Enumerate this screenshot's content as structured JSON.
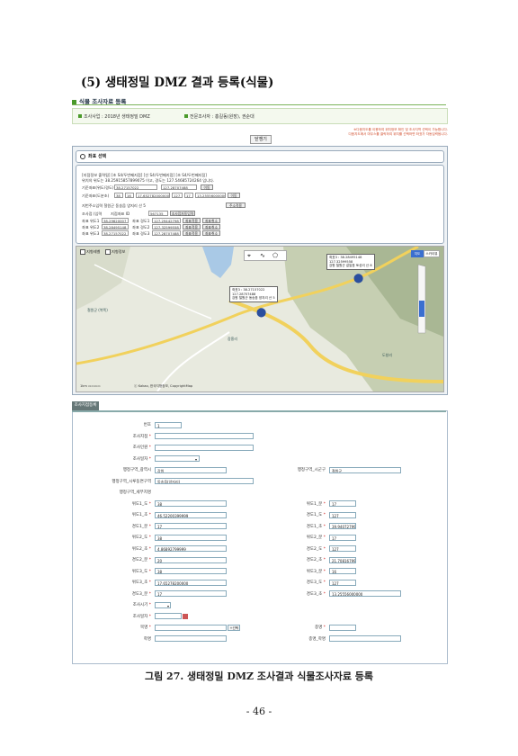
{
  "heading": "(5) 생태정밀 DMZ 결과 등록(식물)",
  "section_title": "식물 조사자료 등록",
  "info": {
    "project_label": "조사사업 : 2018년 생태정밀 DMZ",
    "surveyor_label": "전문조사자 : 홍길동(원장), 권순대"
  },
  "notes": [
    "※다음지도를 이용하여 위치정보 확인 및 조사지역 선택이 가능합니다.",
    "다음지도에서 마우스를 클릭하여 위치를 선택하면 좌표가 자동입력됩니다."
  ],
  "view_button": "닫쟁기",
  "coord_panel": {
    "title": "좌표 선택",
    "desc1": "[지점정보 출력됨] [초 S4/두번째지점] [선 S4/두번째지점] [초 S4/두번째지점]",
    "desc2": "위치의 위도는 38.25915857899075 이고, 경도는 127.54685724264 입니다.",
    "row1_label": "기준좌표(위도/경도)",
    "row1_val1": "38.27157022",
    "row1_val2": "127.28707488",
    "row1_btn": "이동",
    "row2_label": "기준좌표(도분초)",
    "row2_vals": [
      "38",
      "16",
      "17.652782000000",
      "127",
      "17",
      "13.25556000000"
    ],
    "row2_btn": "이동",
    "addr_label": "지번주소입력 철원군 동송읍 양지리 산 5",
    "addr_btn": "주소적용",
    "survey_label": "조사점 (입력",
    "survey_field": "지점좌표 ID",
    "survey_id": "567135",
    "survey_btn": "조사점자동입력",
    "points": [
      {
        "label": "좌표 위도1",
        "lat": "38.29620007",
        "lng_label": "좌표 경도1",
        "lng": "127.29442798",
        "a": "좌표적용",
        "b": "좌표취소"
      },
      {
        "label": "좌표 위도2",
        "lat": "38.28495148",
        "lng_label": "좌표 경도2",
        "lng": "127.32599558",
        "a": "좌표적용",
        "b": "좌표취소"
      },
      {
        "label": "좌표 위도3",
        "lat": "38.27157022",
        "lng_label": "좌표 경도3",
        "lng": "127.28707488",
        "a": "좌표적용",
        "b": "좌표취소"
      }
    ]
  },
  "map": {
    "opt1": "지형레벨",
    "opt2": "지형정보",
    "type1": "지도",
    "type2": "스카이뷰",
    "callout1": [
      "좌표3 : 38.28495148",
      "127.32599558",
      "강원 철원군 갈말읍 토성리 산 8"
    ],
    "callout2": [
      "좌표3 : 38.27157022",
      "127.28707488",
      "강원 철원군 동송읍 양지리 산 5"
    ],
    "place1": "철원군 (북쪽)",
    "place2": "장흥리",
    "place3": "도창리",
    "copyright": "ⓒ Kakao, 한국지형정보, CopyrightMap",
    "scale": "1km"
  },
  "form_tab": "조사지점등록",
  "form": {
    "no_label": "번호",
    "no_val": "1",
    "site_label": "조사지점",
    "surveyor_label": "조사인원",
    "date_label": "조사일자",
    "prov_label": "행정구역_광역시",
    "prov_val": "강원",
    "city_label": "행정구역_시군구",
    "city_val": "철원군",
    "town_label": "행정구역_시루동면구역",
    "town_val": "동송읍(양지리)",
    "addr_label": "행정구역_세부지명",
    "rows": [
      {
        "l": "위도1_도",
        "lv": "38",
        "r": "위도1_분",
        "rv": "17"
      },
      {
        "l": "위도1_초",
        "lv": "46.52200399999",
        "r": "경도1_도",
        "rv": "127"
      },
      {
        "l": "경도1_분",
        "lv": "17",
        "r": "경도1_초",
        "rv": "39.94072799999"
      },
      {
        "l": "위도2_도",
        "lv": "38",
        "r": "위도2_분",
        "rv": "17"
      },
      {
        "l": "위도2_초",
        "lv": "4.86892799999",
        "r": "경도2_도",
        "rv": "127"
      },
      {
        "l": "경도2_분",
        "lv": "20",
        "r": "경도2_초",
        "rv": "21.70816799999"
      },
      {
        "l": "위도3_도",
        "lv": "38",
        "r": "위도3_분",
        "rv": "16"
      },
      {
        "l": "위도3_초",
        "lv": "17.65278200000",
        "r": "경도3_도",
        "rv": "127"
      },
      {
        "l": "경도3_분",
        "lv": "17",
        "r": "경도3_초",
        "rv": "13.25556000000"
      }
    ],
    "time_label": "조사시기",
    "start_label": "조사일자",
    "scope_label": "목명",
    "scope_btn": "+선택",
    "sci_label": "종명",
    "kor_label": "학명",
    "kor2_label": "종명_학명"
  },
  "caption": "그림 27. 생태정밀 DMZ 조사결과 식물조사자료 등록",
  "page_number": "- 46 -"
}
